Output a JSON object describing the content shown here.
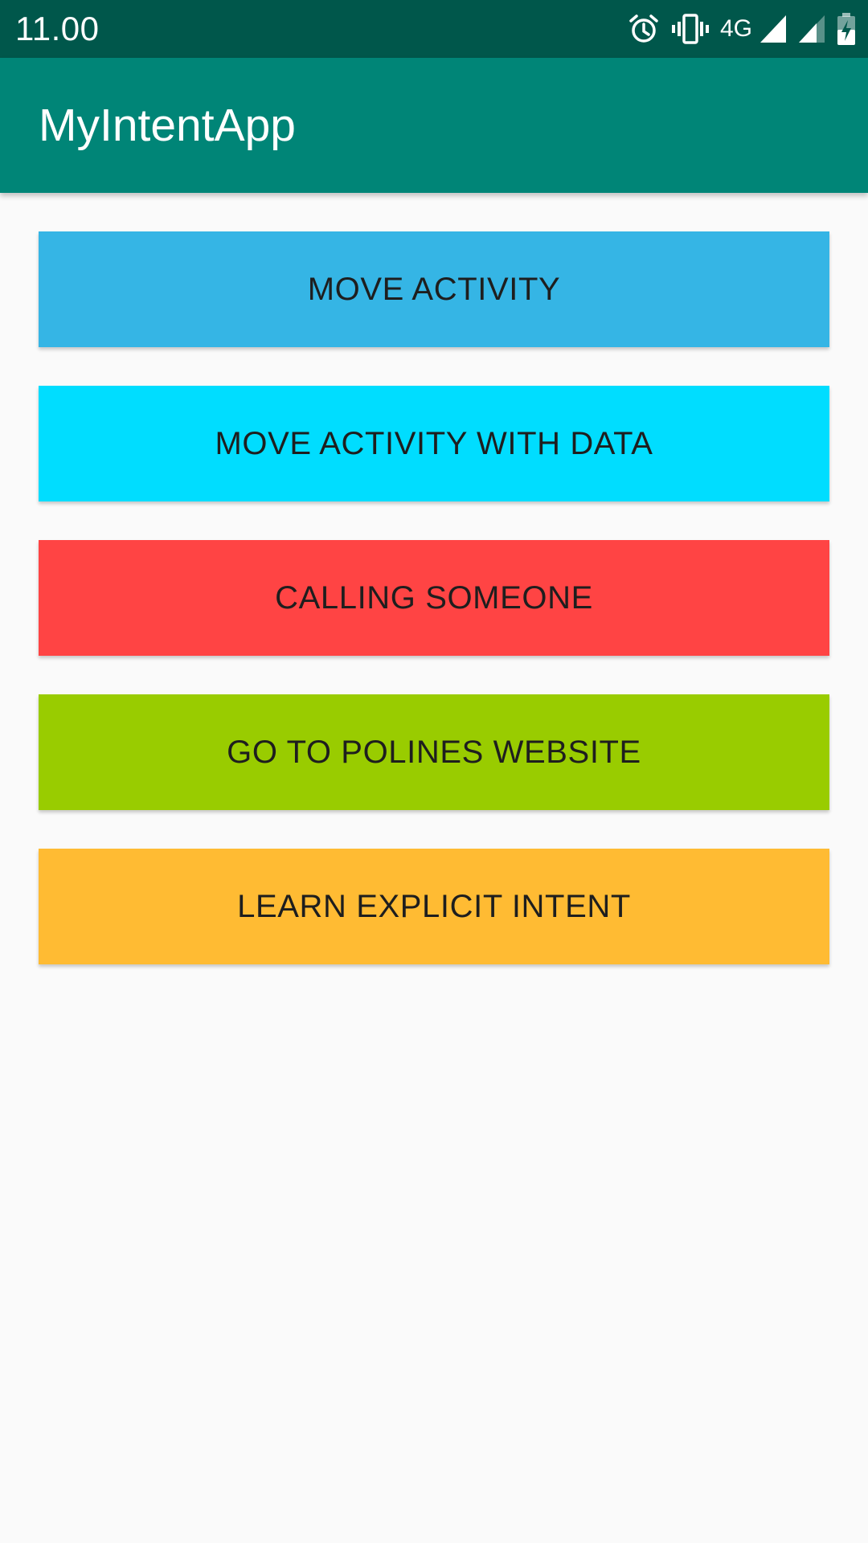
{
  "status_bar": {
    "time": "11.00",
    "network": "4G",
    "icons": [
      "alarm-icon",
      "vibrate-icon",
      "signal-icon",
      "signal-icon",
      "battery-charging-icon"
    ]
  },
  "app_bar": {
    "title": "MyIntentApp",
    "color": "#008577"
  },
  "buttons": [
    {
      "label": "MOVE ACTIVITY",
      "color": "#35b5e5"
    },
    {
      "label": "MOVE ACTIVITY WITH DATA",
      "color": "#00ddff"
    },
    {
      "label": "CALLING SOMEONE",
      "color": "#ff4444"
    },
    {
      "label": "GO TO POLINES WEBSITE",
      "color": "#99cc00"
    },
    {
      "label": "LEARN EXPLICIT INTENT",
      "color": "#ffbb33"
    }
  ]
}
